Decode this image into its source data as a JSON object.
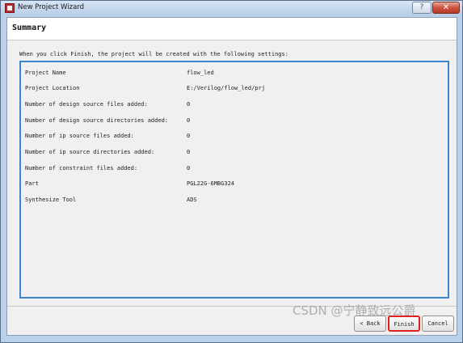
{
  "window": {
    "title": "New Project Wizard",
    "help_glyph": "?",
    "close_glyph": "✕",
    "app_icon": "app-icon",
    "accent_color": "#3b86cf"
  },
  "header": {
    "title": "Summary"
  },
  "intro_text": "When you click Finish, the project will be created with the following settings:",
  "settings": [
    {
      "label": "Project Name",
      "value": "flow_led"
    },
    {
      "label": "Project Location",
      "value": "E:/Verilog/flow_led/prj"
    },
    {
      "label": "Number of design source files added:",
      "value": "0"
    },
    {
      "label": "Number of design source directories added:",
      "value": "0"
    },
    {
      "label": "Number of ip source files added:",
      "value": "0"
    },
    {
      "label": "Number of ip source directories added:",
      "value": "0"
    },
    {
      "label": "Number of constraint files added:",
      "value": "0"
    },
    {
      "label": "Part",
      "value": "PGL22G-6MBG324"
    },
    {
      "label": "Synthesize Tool",
      "value": "ADS"
    }
  ],
  "buttons": {
    "back": "< Back",
    "finish": "Finish",
    "cancel": "Cancel",
    "finish_highlight_color": "#e02020"
  },
  "watermark": "CSDN @宁静致远公爵"
}
